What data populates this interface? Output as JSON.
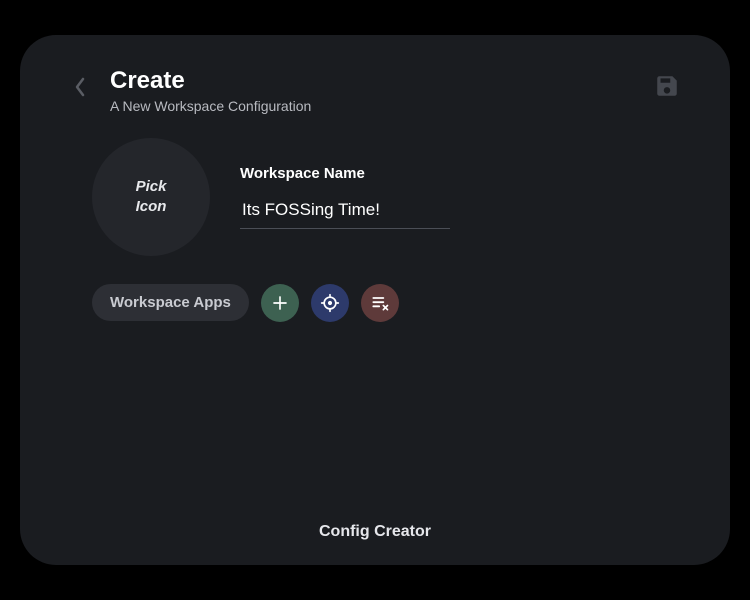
{
  "header": {
    "title": "Create",
    "subtitle": "A New Workspace Configuration"
  },
  "iconPicker": {
    "label": "Pick\nIcon"
  },
  "nameField": {
    "label": "Workspace Name",
    "value": "Its FOSSing Time!"
  },
  "appsSection": {
    "label": "Workspace Apps"
  },
  "footer": {
    "label": "Config Creator"
  }
}
